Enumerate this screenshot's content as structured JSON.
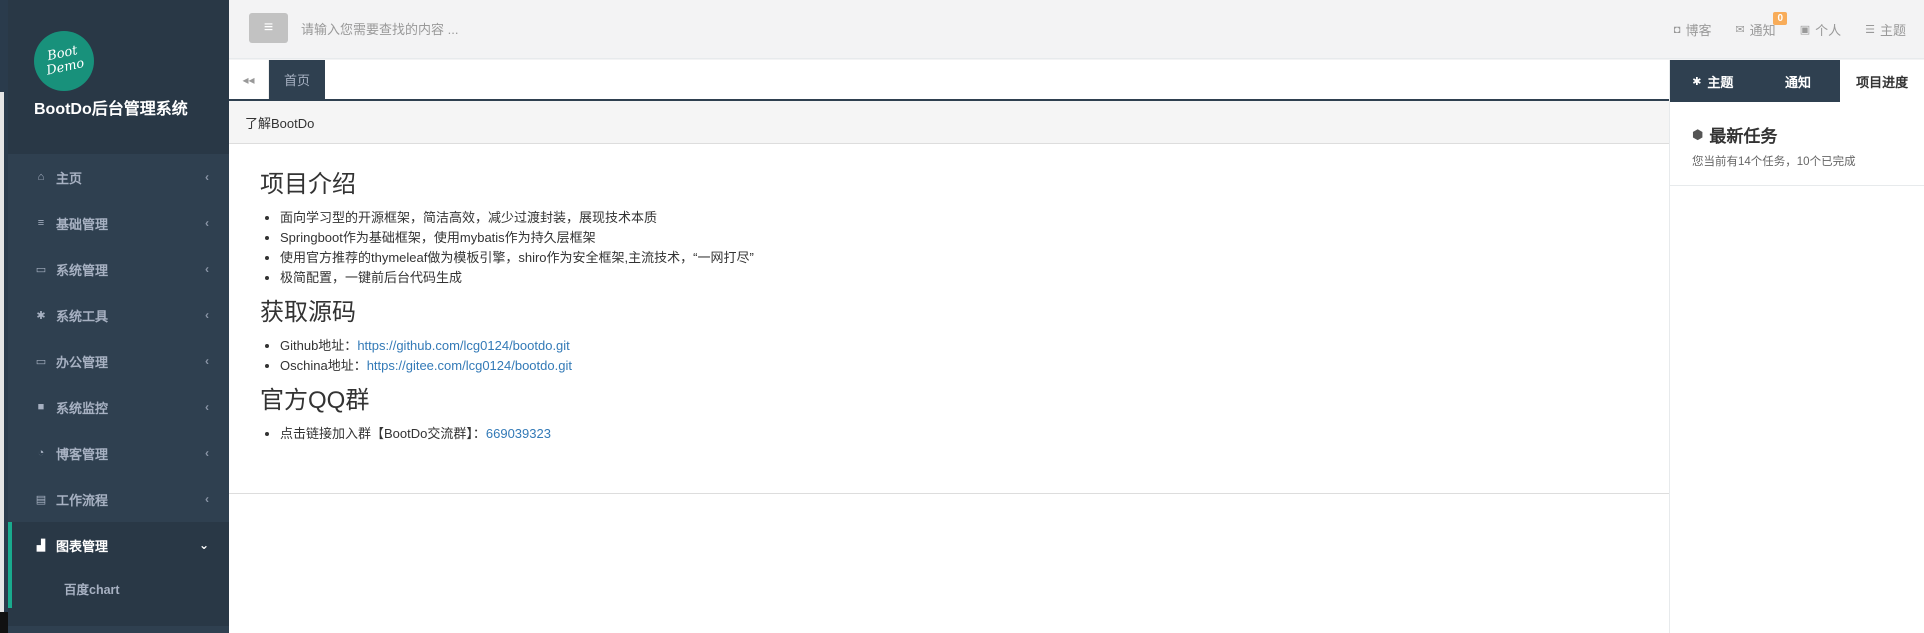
{
  "app": {
    "logo_text": "Boot Demo",
    "title": "BootDo后台管理系统"
  },
  "sidebar": {
    "items": [
      {
        "label": "主页",
        "icon": "home-icon",
        "glyph": "⌂",
        "arrow": "‹"
      },
      {
        "label": "基础管理",
        "icon": "bars-icon",
        "glyph": "≡",
        "arrow": "‹"
      },
      {
        "label": "系统管理",
        "icon": "desktop-icon",
        "glyph": "▭",
        "arrow": "‹"
      },
      {
        "label": "系统工具",
        "icon": "gear-icon",
        "glyph": "✱",
        "arrow": "‹"
      },
      {
        "label": "办公管理",
        "icon": "laptop-icon",
        "glyph": "▭",
        "arrow": "‹"
      },
      {
        "label": "系统监控",
        "icon": "video-camera-icon",
        "glyph": "■",
        "arrow": "‹"
      },
      {
        "label": "博客管理",
        "icon": "rss-icon",
        "glyph": "◔",
        "arrow": "‹"
      },
      {
        "label": "工作流程",
        "icon": "print-icon",
        "glyph": "▤",
        "arrow": "‹"
      },
      {
        "label": "图表管理",
        "icon": "bar-chart-icon",
        "glyph": "▟",
        "arrow": "⌄"
      }
    ],
    "submenu": {
      "label": "百度chart"
    }
  },
  "topbar": {
    "toggle_glyph": "≡",
    "search_placeholder": "请输入您需要查找的内容 ...",
    "links": [
      {
        "label": "博客",
        "icon": "rss-icon",
        "glyph": "◘"
      },
      {
        "label": "通知",
        "icon": "envelope-icon",
        "glyph": "✉",
        "badge": "0"
      },
      {
        "label": "个人",
        "icon": "id-card-icon",
        "glyph": "▣"
      },
      {
        "label": "主题",
        "icon": "tasks-icon",
        "glyph": "☰"
      }
    ]
  },
  "tabs": {
    "back_glyph": "◂◂",
    "home_label": "首页"
  },
  "main": {
    "panel_title": "了解BootDo",
    "sections": {
      "intro": {
        "heading": "项目介绍",
        "items": [
          "面向学习型的开源框架，简洁高效，减少过渡封装，展现技术本质",
          "Springboot作为基础框架，使用mybatis作为持久层框架",
          "使用官方推荐的thymeleaf做为模板引擎，shiro作为安全框架,主流技术，“一网打尽”",
          "极简配置，一键前后台代码生成"
        ]
      },
      "source": {
        "heading": "获取源码",
        "github_label": "Github地址：",
        "github_url": "https://github.com/lcg0124/bootdo.git",
        "oschina_label": "Oschina地址：",
        "oschina_url": "https://gitee.com/lcg0124/bootdo.git"
      },
      "qq": {
        "heading": "官方QQ群",
        "label": "点击链接加入群【BootDo交流群】：",
        "number": "669039323"
      }
    }
  },
  "rightbar": {
    "tabs": [
      {
        "label": "主题",
        "glyph": "✱"
      },
      {
        "label": "通知"
      },
      {
        "label": "项目进度"
      }
    ],
    "task_title": "最新任务",
    "task_glyph": "⬢",
    "task_subtitle": "您当前有14个任务，10个已完成"
  }
}
